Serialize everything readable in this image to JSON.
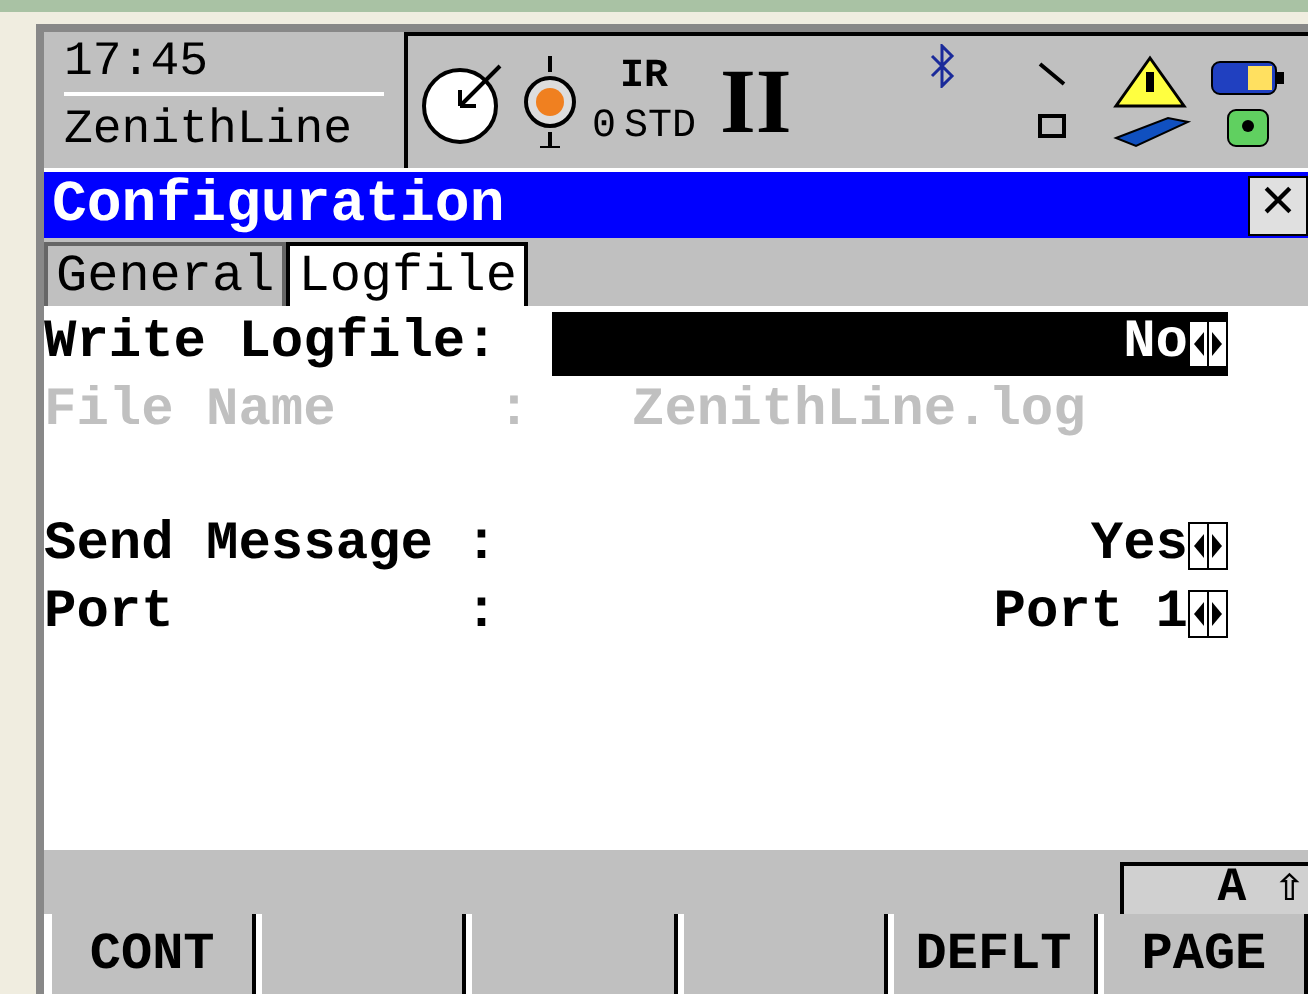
{
  "status_bar": {
    "time": "17:45",
    "instrument": "ZenithLine",
    "edm_mode": "IR",
    "edm_program": "STD",
    "prism_constant": "0",
    "face": "II"
  },
  "window": {
    "title": "Configuration",
    "close": "×"
  },
  "tabs": [
    {
      "label": "General",
      "selected": false
    },
    {
      "label": "Logfile",
      "selected": true
    }
  ],
  "fields": [
    {
      "label": "Write Logfile:",
      "value": "No",
      "kind": "choice",
      "selected": true,
      "disabled": false
    },
    {
      "label": "File Name     :",
      "value": "ZenithLine.log",
      "kind": "text",
      "selected": false,
      "disabled": true
    },
    {
      "kind": "spacer"
    },
    {
      "label": "Send Message :",
      "value": "Yes",
      "kind": "choice",
      "selected": false,
      "disabled": false
    },
    {
      "label": "Port         :",
      "value": "Port 1",
      "kind": "choice",
      "selected": false,
      "disabled": false
    }
  ],
  "input_mode": "A ⇧",
  "softkeys": [
    {
      "kind": "key",
      "label": "CONT"
    },
    {
      "kind": "blank"
    },
    {
      "kind": "blank"
    },
    {
      "kind": "blank"
    },
    {
      "kind": "key",
      "label": "DEFLT"
    },
    {
      "kind": "key",
      "label": "PAGE"
    }
  ]
}
